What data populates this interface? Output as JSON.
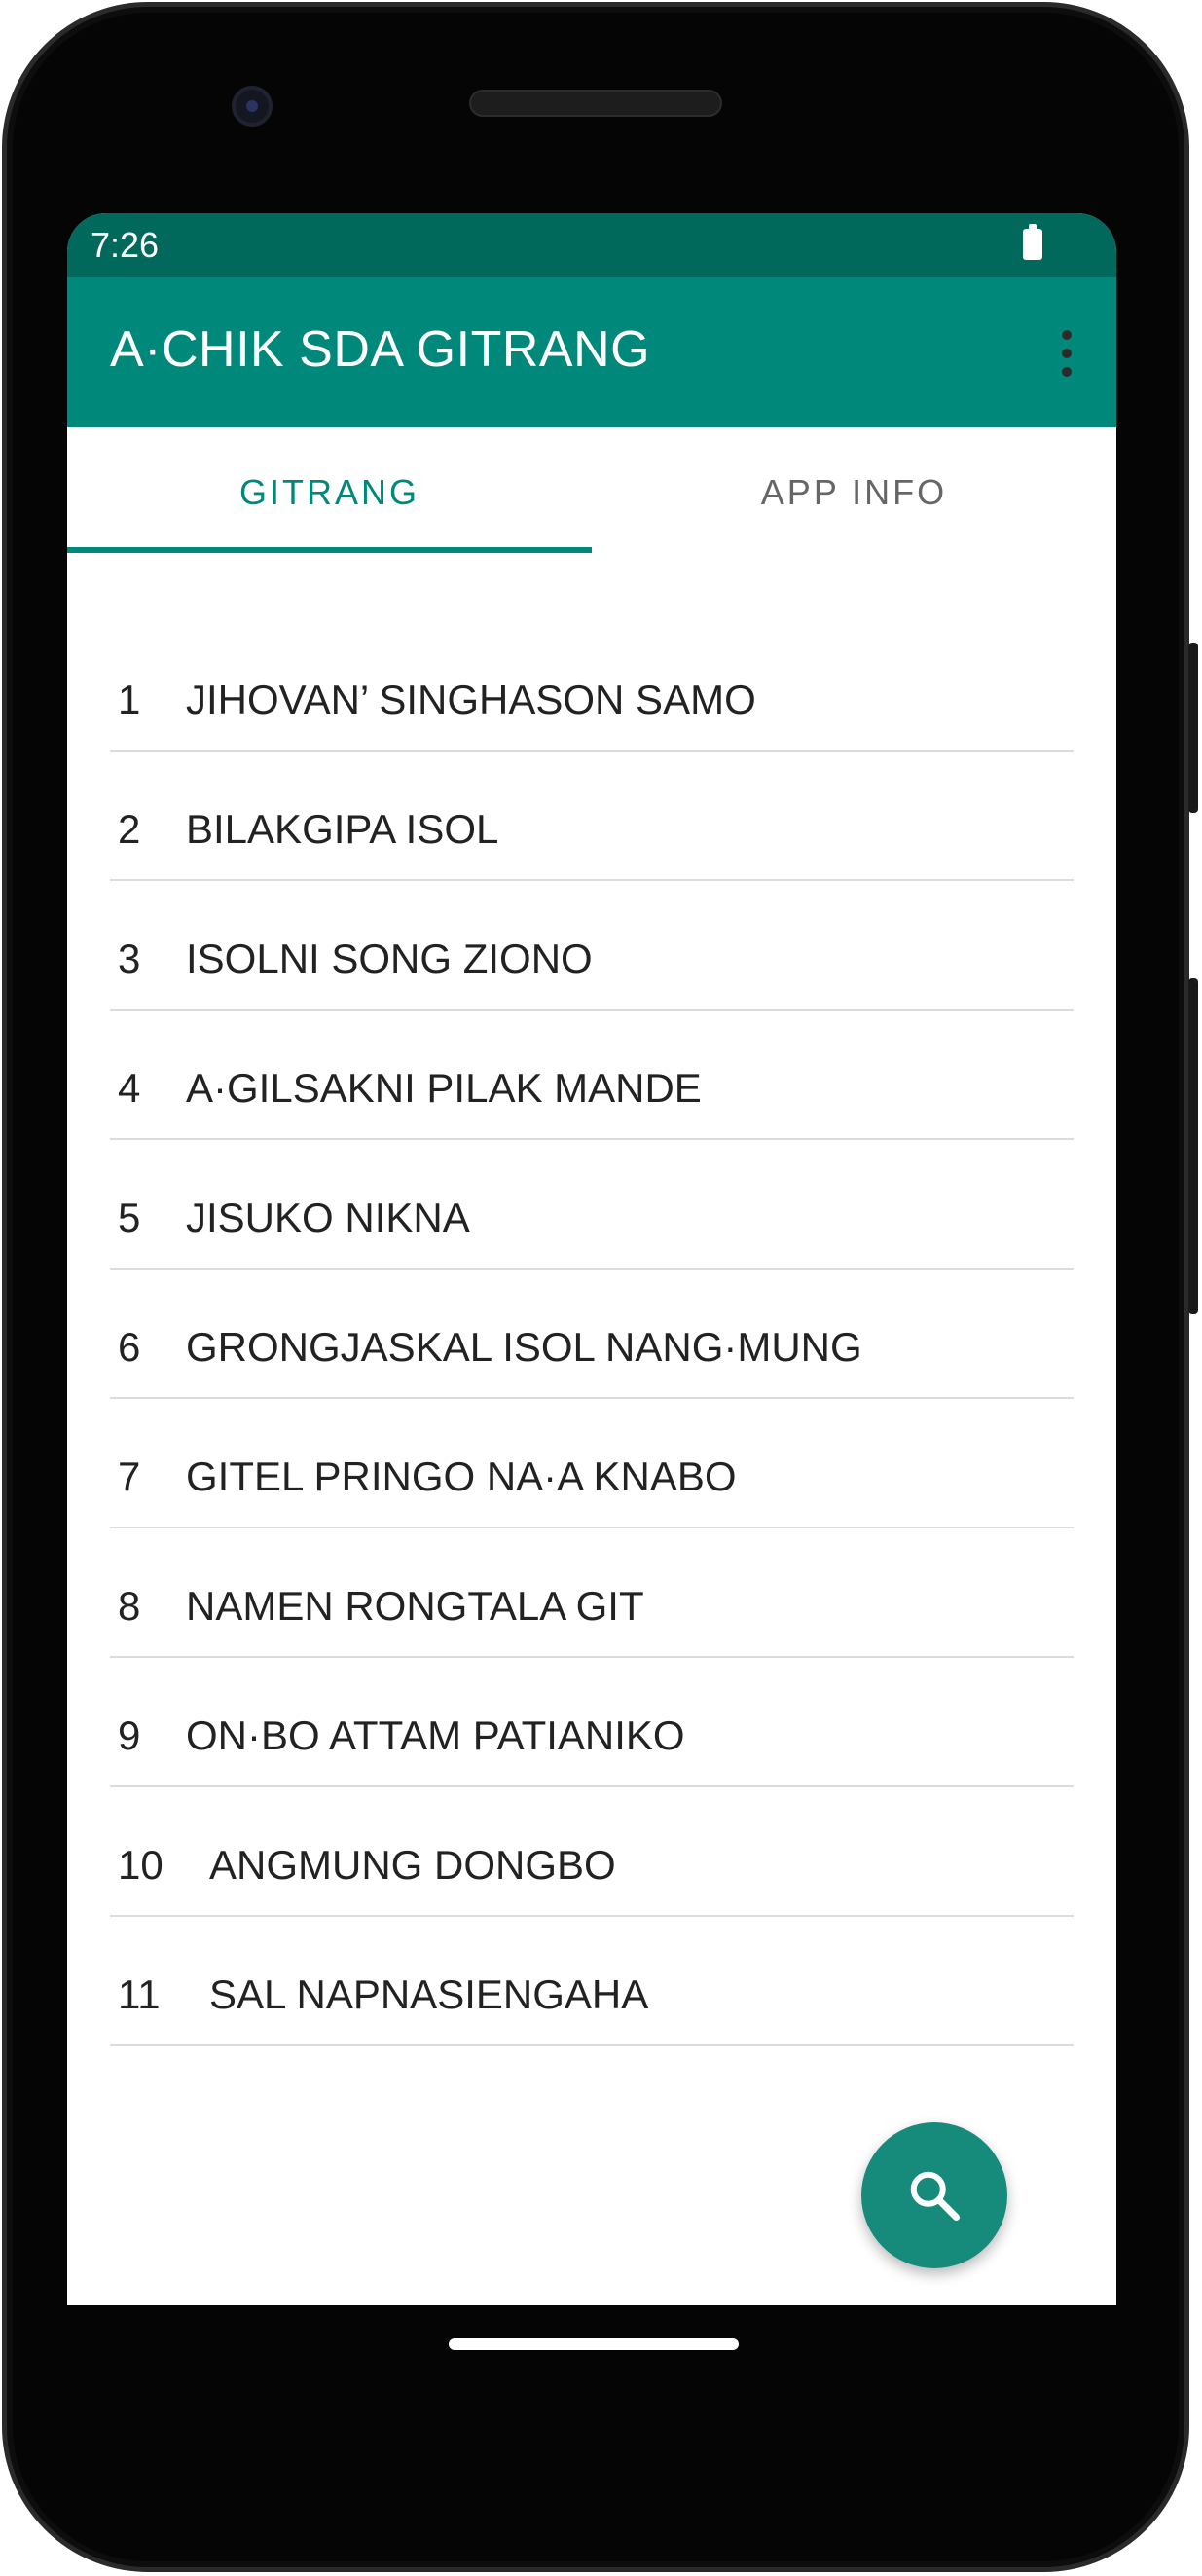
{
  "status_bar": {
    "time": "7:26",
    "battery_icon": "battery-full-icon"
  },
  "app_bar": {
    "title": "A·CHIK SDA GITRANG",
    "menu_icon": "more-vert-icon"
  },
  "tabs": [
    {
      "label": "GITRANG",
      "selected": true
    },
    {
      "label": "APP INFO",
      "selected": false
    }
  ],
  "songs": [
    {
      "number": "1",
      "title": "JIHOVAN’ SINGHASON SAMO"
    },
    {
      "number": "2",
      "title": "BILAKGIPA ISOL"
    },
    {
      "number": "3",
      "title": "ISOLNI SONG ZIONO"
    },
    {
      "number": "4",
      "title": "A·GILSAKNI PILAK MANDE"
    },
    {
      "number": "5",
      "title": "JISUKO NIKNA"
    },
    {
      "number": "6",
      "title": "GRONGJASKAL ISOL NANG·MUNG"
    },
    {
      "number": "7",
      "title": "GITEL PRINGO NA·A KNABO"
    },
    {
      "number": "8",
      "title": "NAMEN RONGTALA GIT"
    },
    {
      "number": "9",
      "title": "ON·BO ATTAM PATIANIKO"
    },
    {
      "number": "10",
      "title": "ANGMUNG DONGBO"
    },
    {
      "number": "11",
      "title": "SAL NAPNASIENGAHA"
    }
  ],
  "fab": {
    "icon": "search-icon"
  },
  "colors": {
    "status_bar": "#00695c",
    "app_bar": "#00897b",
    "accent": "#00897b",
    "fab": "#168a7b"
  }
}
